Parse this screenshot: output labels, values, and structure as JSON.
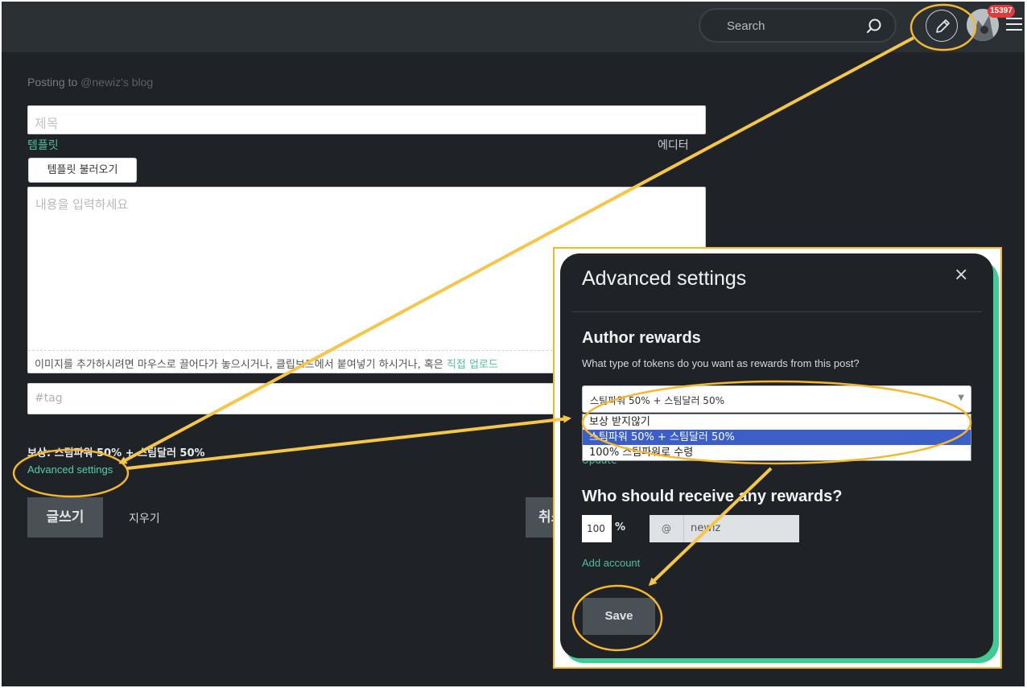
{
  "header": {
    "search_placeholder": "Search",
    "notification_count": "15397"
  },
  "editor": {
    "posting_to_prefix": "Posting to ",
    "posting_to_blog": "@newiz's blog",
    "title_placeholder": "제목",
    "template_link": "템플릿",
    "editor_link": "에디터",
    "template_load_button": "템플릿 불러오기",
    "body_placeholder": "내용을 입력하세요",
    "upload_hint": "이미지를 추가하시려면 마우스로 끌어다가 놓으시거나, 클립보드에서 붙여넣기 하시거나, 혹은 ",
    "upload_link": "직접 업로드",
    "tag_placeholder": "#tag",
    "reward_summary": "보상: 스팀파워 50% + 스팀달러 50%",
    "advanced_settings_link": "Advanced settings",
    "post_button": "글쓰기",
    "clear_button": "지우기",
    "cancel_button": "취소"
  },
  "modal": {
    "title": "Advanced settings",
    "close_icon": "×",
    "author_rewards_heading": "Author rewards",
    "rewards_question": "What type of tokens do you want as rewards from this post?",
    "selected_option": "스팀파워 50% + 스팀달러 50%",
    "options": [
      "보상 받지않기",
      "스팀파워 50% + 스팀달러 50%",
      "100% 스팀파워로 수령"
    ],
    "hidden_link_text": "Update",
    "receive_heading": "Who should receive any rewards?",
    "percent_value": "100",
    "percent_sign": "%",
    "at_prefix": "@",
    "account_value": "newiz",
    "add_account_link": "Add account",
    "save_button": "Save"
  },
  "colors": {
    "accent_green": "#4fbf9a",
    "annotation_yellow": "#f4b72f",
    "selected_option_blue": "#3b5fc6"
  }
}
